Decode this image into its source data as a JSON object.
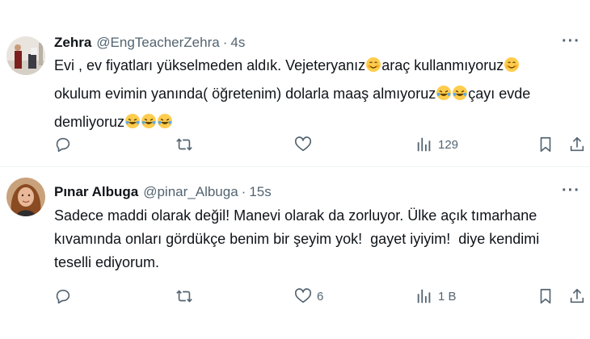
{
  "tweets": [
    {
      "name": "Zehra",
      "handle": "@EngTeacherZehra",
      "separator": "·",
      "time": "4s",
      "lines": [
        [
          "Evi , ev fiyatları yükselmeden aldık. Vejeteryanız",
          "☺",
          "araç kullanmıyoruz",
          "☺"
        ],
        [
          "okulum evimin yanında( öğretenim) dolarla maaş almıyoruz",
          "😂😂",
          "çayı evde"
        ],
        [
          "demliyoruz",
          "😂😂😂"
        ]
      ],
      "actions": {
        "reply": "",
        "retweet": "",
        "like": "",
        "views": "129"
      }
    },
    {
      "name": "Pınar Albuga",
      "handle": "@pinar_Albuga",
      "separator": "·",
      "time": "15s",
      "text_lines": [
        "Sadece maddi olarak değil! Manevi olarak da zorluyor. Ülke açık tımarhane",
        "kıvamında onları gördükçe benim bir şeyim yok!  gayet iyiyim!  diye kendimi",
        "teselli ediyorum."
      ],
      "actions": {
        "reply": "",
        "retweet": "",
        "like": "6",
        "views": "1 B"
      }
    }
  ],
  "icons": {
    "more": "more-horizontal-icon",
    "reply": "reply-icon",
    "retweet": "retweet-icon",
    "like": "heart-icon",
    "views": "views-chart-icon",
    "bookmark": "bookmark-icon",
    "share": "share-icon"
  },
  "colors": {
    "text": "#0f1419",
    "secondary": "#536471",
    "divider": "#eff3f4"
  }
}
